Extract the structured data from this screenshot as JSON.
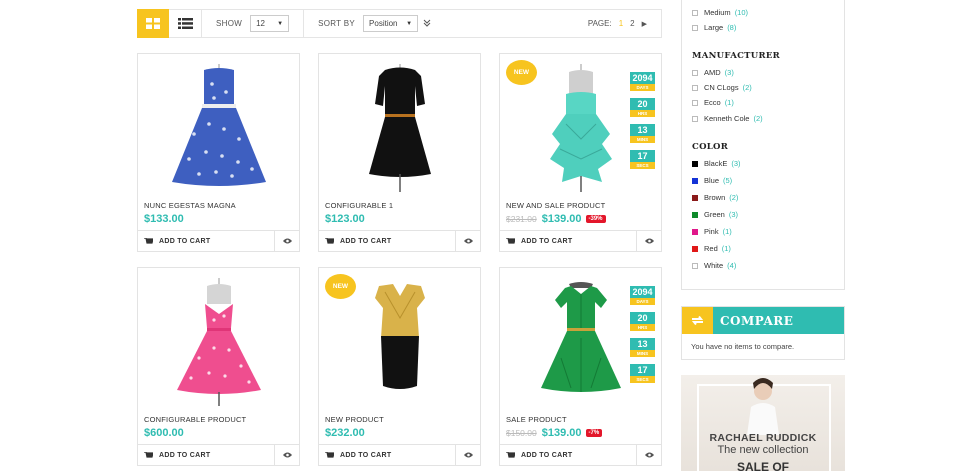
{
  "toolbar": {
    "show_label": "SHOW",
    "show_value": "12",
    "sort_label": "SORT BY",
    "sort_value": "Position",
    "page_label": "PAGE:",
    "pages": [
      "1",
      "2"
    ]
  },
  "products": [
    {
      "name": "NUNC EGESTAS MAGNA",
      "price": "$133.00",
      "old_price": "",
      "discount": "",
      "badge": "",
      "cart": "ADD TO CART"
    },
    {
      "name": "CONFIGURABLE 1",
      "price": "$123.00",
      "old_price": "",
      "discount": "",
      "badge": "",
      "cart": "ADD TO CART"
    },
    {
      "name": "NEW AND SALE PRODUCT",
      "price": "$139.00",
      "old_price": "$231.00",
      "discount": "-39%",
      "badge": "NEW",
      "cart": "ADD TO CART",
      "countdown": [
        {
          "n": "2094",
          "u": "DAYS"
        },
        {
          "n": "20",
          "u": "HRS"
        },
        {
          "n": "13",
          "u": "MINS"
        },
        {
          "n": "17",
          "u": "SECS"
        }
      ]
    },
    {
      "name": "CONFIGURABLE PRODUCT",
      "price": "$600.00",
      "old_price": "",
      "discount": "",
      "badge": "",
      "cart": "ADD TO CART"
    },
    {
      "name": "NEW PRODUCT",
      "price": "$232.00",
      "old_price": "",
      "discount": "",
      "badge": "NEW",
      "cart": "ADD TO CART"
    },
    {
      "name": "SALE PRODUCT",
      "price": "$139.00",
      "old_price": "$150.00",
      "discount": "-7%",
      "badge": "",
      "cart": "ADD TO CART",
      "countdown": [
        {
          "n": "2094",
          "u": "DAYS"
        },
        {
          "n": "20",
          "u": "HRS"
        },
        {
          "n": "13",
          "u": "MINS"
        },
        {
          "n": "17",
          "u": "SECS"
        }
      ]
    }
  ],
  "sidebar": {
    "size_items": [
      {
        "label": "Medium",
        "count": "(10)"
      },
      {
        "label": "Large",
        "count": "(8)"
      }
    ],
    "manufacturer_title": "MANUFACTURER",
    "manufacturers": [
      {
        "label": "AMD",
        "count": "(3)"
      },
      {
        "label": "CN CLogs",
        "count": "(2)"
      },
      {
        "label": "Ecco",
        "count": "(1)"
      },
      {
        "label": "Kenneth Cole",
        "count": "(2)"
      }
    ],
    "color_title": "COLOR",
    "colors": [
      {
        "label": "BlackE",
        "count": "(3)",
        "swatch": "#000000"
      },
      {
        "label": "Blue",
        "count": "(5)",
        "swatch": "#1433d6"
      },
      {
        "label": "Brown",
        "count": "(2)",
        "swatch": "#8b1a1a"
      },
      {
        "label": "Green",
        "count": "(3)",
        "swatch": "#0e8a2a"
      },
      {
        "label": "Pink",
        "count": "(1)",
        "swatch": "#e0178a"
      },
      {
        "label": "Red",
        "count": "(1)",
        "swatch": "#e01818"
      },
      {
        "label": "White",
        "count": "(4)",
        "swatch": "#ffffff"
      }
    ]
  },
  "compare": {
    "title": "COMPARE",
    "message": "You have no items to compare."
  },
  "banner": {
    "line1": "RACHAEL RUDDICK",
    "line2": "The new collection",
    "line3": "SALE OF"
  },
  "colors": {
    "accent": "#2fbcb1",
    "yellow": "#f7c41f",
    "sale_red": "#e3162a"
  }
}
